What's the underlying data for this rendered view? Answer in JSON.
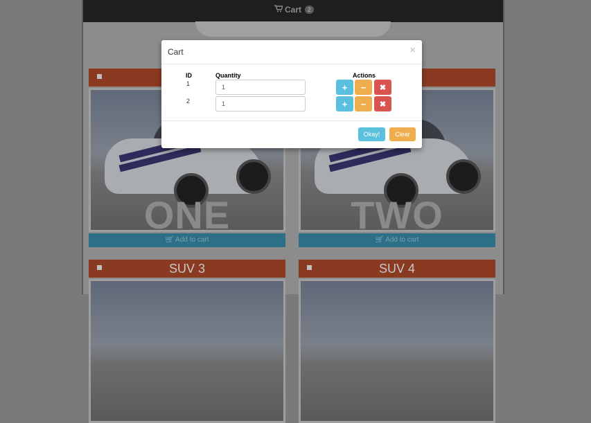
{
  "navbar": {
    "cart_label": "Cart",
    "cart_count": "2",
    "cart_icon": "shopping-cart-icon"
  },
  "cards": [
    {
      "image_text": "ONE",
      "add_label": "Add to cart"
    },
    {
      "image_text": "TWO",
      "add_label": "Add to cart"
    },
    {
      "title": "SUV 3"
    },
    {
      "title": "SUV 4"
    }
  ],
  "modal": {
    "title": "Cart",
    "close": "×",
    "headers": {
      "id": "ID",
      "quantity": "Quantity",
      "actions": "Actions"
    },
    "rows": [
      {
        "id": "1",
        "quantity": "1"
      },
      {
        "id": "2",
        "quantity": "1"
      }
    ],
    "actions": {
      "plus": "+",
      "minus": "−",
      "remove": "✖"
    },
    "okay_label": "Okay!",
    "clear_label": "Clear"
  },
  "colors": {
    "info": "#5bc0de",
    "warning": "#f0ad4e",
    "danger": "#d9534f",
    "card_header": "#e0552a",
    "add_button": "#3ba3c8"
  }
}
